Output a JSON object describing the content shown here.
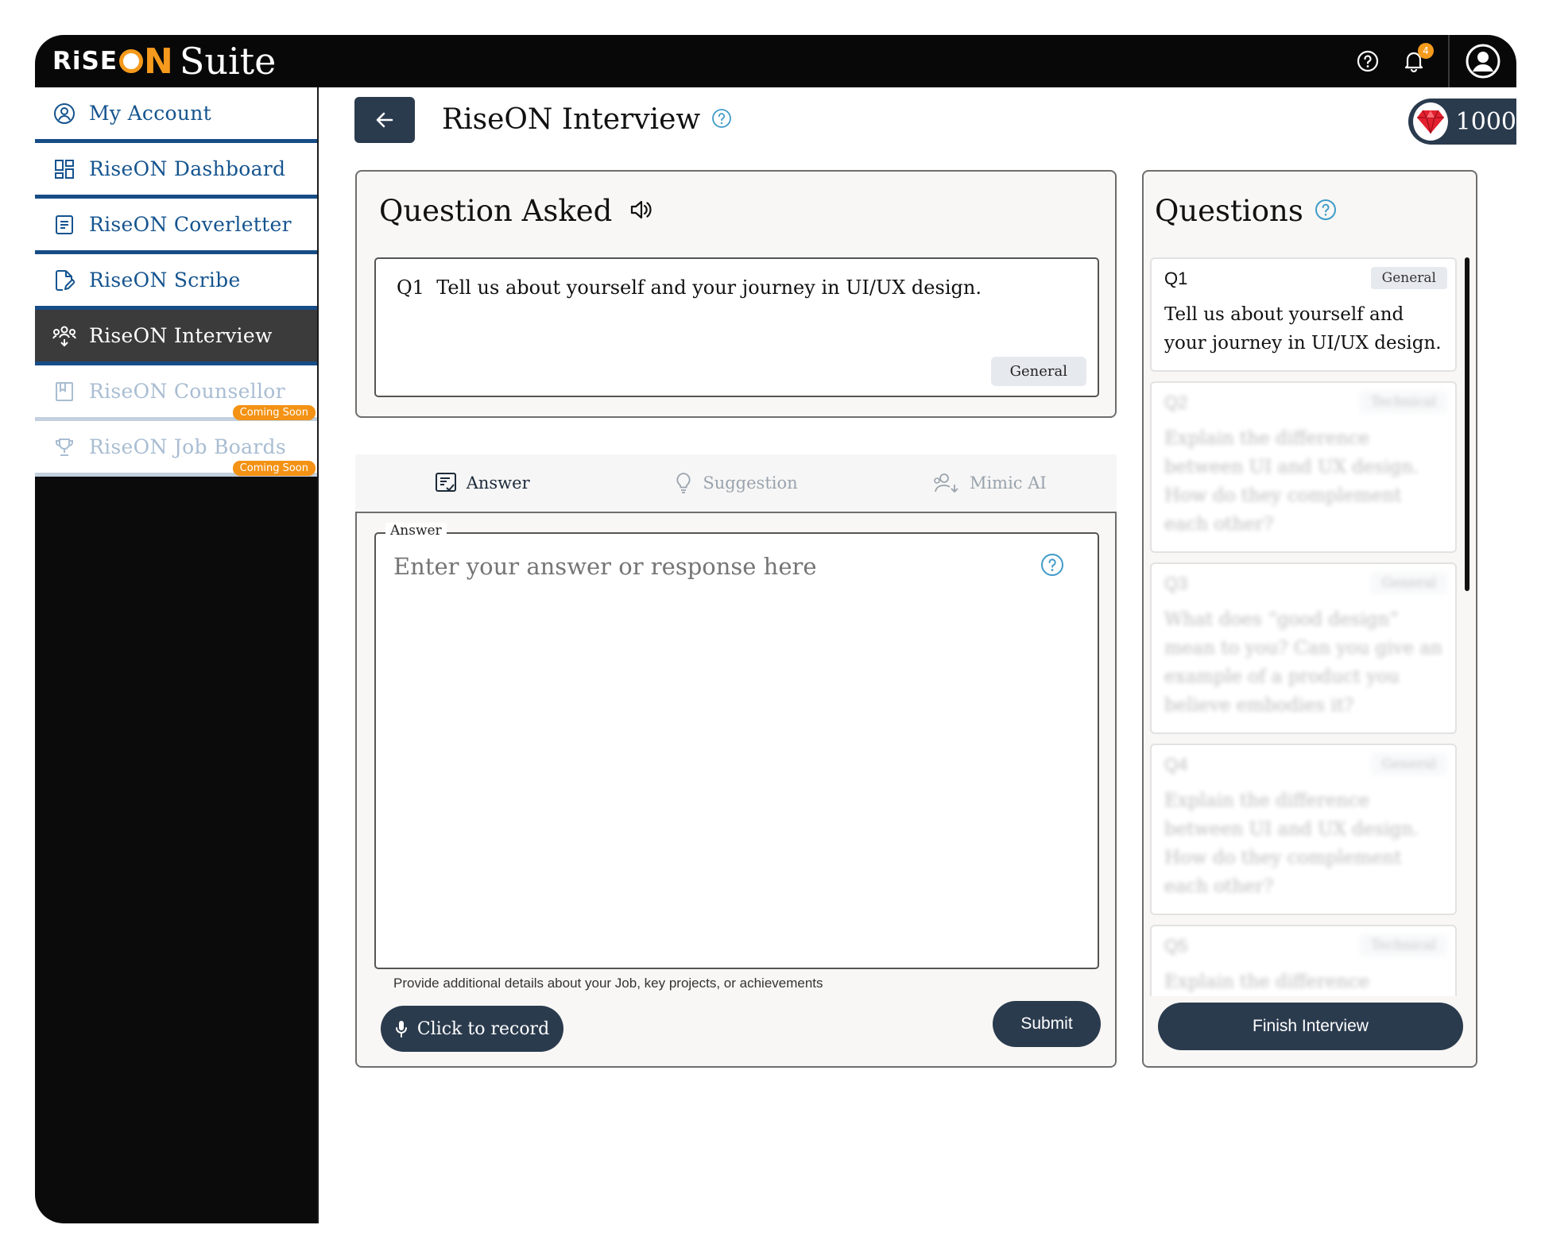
{
  "brand": {
    "rise": "RiSE",
    "on": "N",
    "suite": "Suite"
  },
  "topbar": {
    "notification_count": "4"
  },
  "sidebar": {
    "items": [
      {
        "label": "My Account",
        "icon": "user-circle-icon",
        "state": "normal"
      },
      {
        "label": "RiseON Dashboard",
        "icon": "dashboard-grid-icon",
        "state": "normal"
      },
      {
        "label": "RiseON Coverletter",
        "icon": "document-icon",
        "state": "normal"
      },
      {
        "label": "RiseON Scribe",
        "icon": "file-edit-icon",
        "state": "normal"
      },
      {
        "label": "RiseON Interview",
        "icon": "interview-people-icon",
        "state": "active"
      },
      {
        "label": "RiseON Counsellor",
        "icon": "book-icon",
        "state": "disabled",
        "badge": "Coming Soon"
      },
      {
        "label": "RiseON Job Boards",
        "icon": "trophy-icon",
        "state": "disabled",
        "badge": "Coming Soon"
      }
    ]
  },
  "header": {
    "title": "RiseON Interview",
    "credits": "1000"
  },
  "question_card": {
    "title": "Question Asked",
    "number": "Q1",
    "text": "Tell us about yourself and your journey in UI/UX design.",
    "tag": "General"
  },
  "tabs": [
    {
      "label": "Answer",
      "icon": "answer-list-icon",
      "active": true
    },
    {
      "label": "Suggestion",
      "icon": "lightbulb-icon",
      "active": false
    },
    {
      "label": "Mimic AI",
      "icon": "mimic-users-icon",
      "active": false
    }
  ],
  "answer": {
    "legend": "Answer",
    "placeholder": "Enter your answer or response here",
    "hint": "Provide additional details about your Job, key projects, or achievements",
    "record_label": "Click to record",
    "submit_label": "Submit"
  },
  "questions_panel": {
    "title": "Questions",
    "finish_label": "Finish Interview",
    "items": [
      {
        "number": "Q1",
        "tag": "General",
        "text": "Tell us about yourself and your journey in UI/UX design.",
        "blurred": false
      },
      {
        "number": "Q2",
        "tag": "Technical",
        "text": "Explain the difference between UI and UX design. How do they complement each other?",
        "blurred": true
      },
      {
        "number": "Q3",
        "tag": "General",
        "text": "What does “good design” mean to you? Can you give an example of a product you believe embodies it?",
        "blurred": true
      },
      {
        "number": "Q4",
        "tag": "General",
        "text": "Explain the difference between UI and UX design. How do they complement each other?",
        "blurred": true
      },
      {
        "number": "Q5",
        "tag": "Technical",
        "text": "Explain the difference between UI and UX design. How do they complement each other?",
        "blurred": true
      }
    ]
  },
  "colors": {
    "accent_navy": "#2b3b4e",
    "brand_orange": "#f59a1c",
    "sidebar_link": "#15548f",
    "active_bg": "#3b3b3b"
  }
}
